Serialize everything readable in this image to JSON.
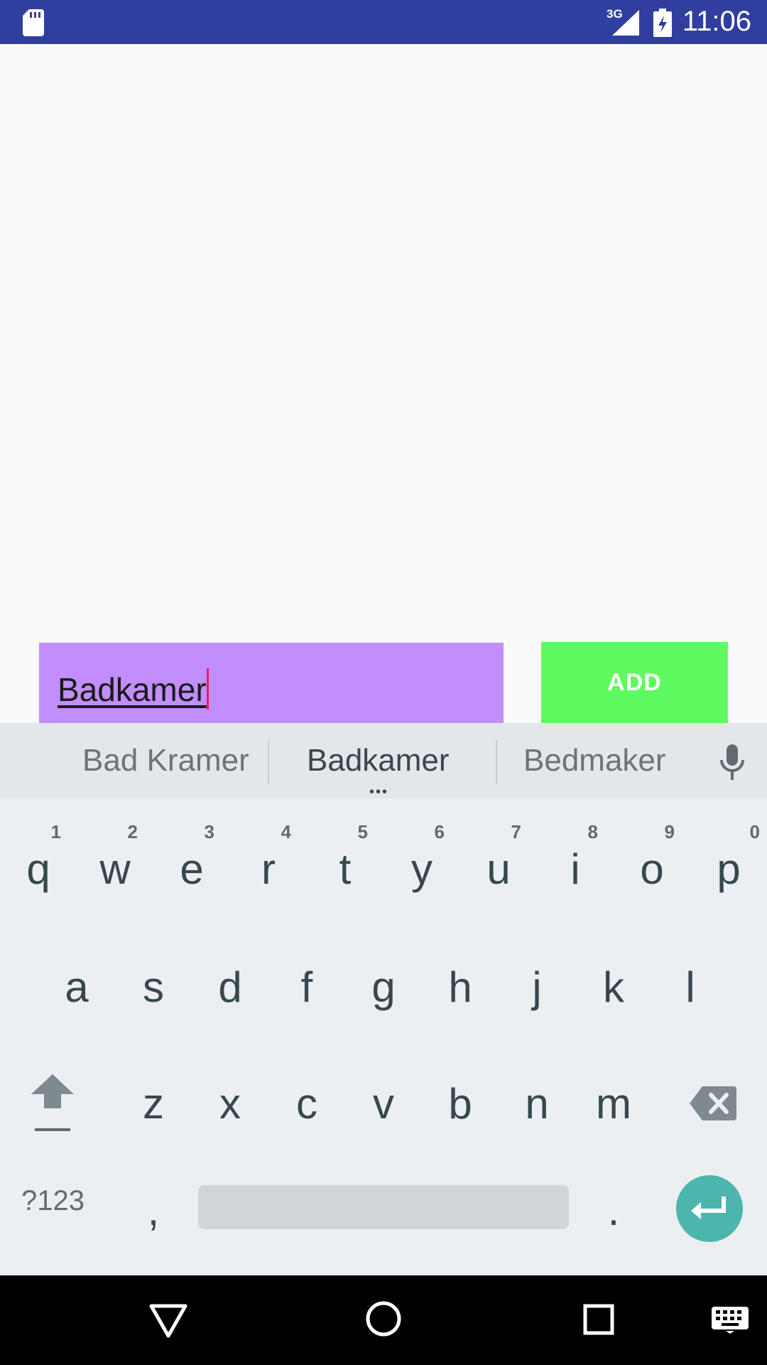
{
  "status_bar": {
    "time": "11:06",
    "network_type": "3G",
    "icons": [
      "sd-card-icon",
      "signal-icon",
      "battery-charging-icon"
    ]
  },
  "form": {
    "input_value": "Badkamer",
    "add_label": "ADD"
  },
  "keyboard": {
    "suggestions": [
      "Bad Kramer",
      "Badkamer",
      "Bedmaker"
    ],
    "row1": [
      {
        "key": "q",
        "hint": "1"
      },
      {
        "key": "w",
        "hint": "2"
      },
      {
        "key": "e",
        "hint": "3"
      },
      {
        "key": "r",
        "hint": "4"
      },
      {
        "key": "t",
        "hint": "5"
      },
      {
        "key": "y",
        "hint": "6"
      },
      {
        "key": "u",
        "hint": "7"
      },
      {
        "key": "i",
        "hint": "8"
      },
      {
        "key": "o",
        "hint": "9"
      },
      {
        "key": "p",
        "hint": "0"
      }
    ],
    "row2": [
      "a",
      "s",
      "d",
      "f",
      "g",
      "h",
      "j",
      "k",
      "l"
    ],
    "row3": [
      "z",
      "x",
      "c",
      "v",
      "b",
      "n",
      "m"
    ],
    "symbols_label": "?123",
    "comma": ",",
    "period": ".",
    "colors": {
      "background": "#eceff1",
      "enter": "#4db6ac",
      "key_text": "#37474f"
    }
  },
  "colors": {
    "status_bar": "#303f9f",
    "input_background": "#c28dfc",
    "add_button": "#5ffa5f",
    "cursor": "#e91e63"
  },
  "navigation": {
    "icons": [
      "back-icon",
      "home-icon",
      "recents-icon",
      "keyboard-switch-icon"
    ]
  }
}
